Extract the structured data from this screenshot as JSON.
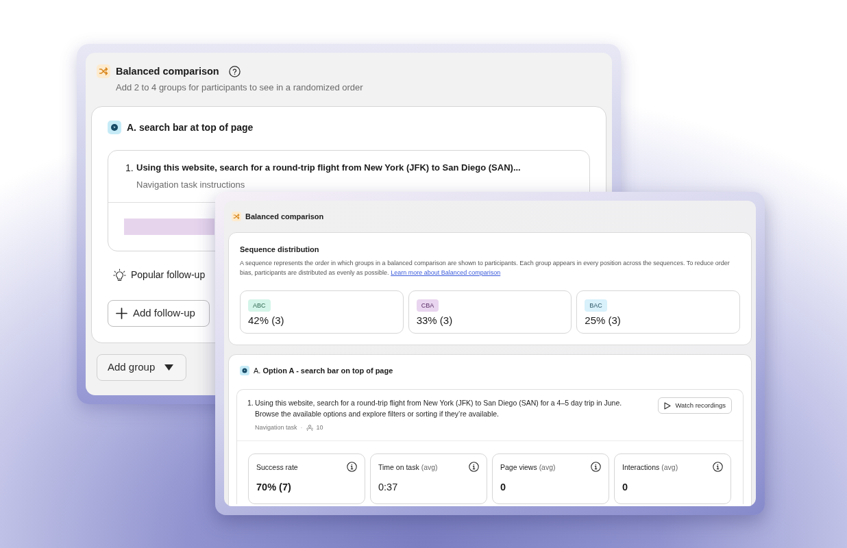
{
  "back_window": {
    "title": "Balanced comparison",
    "subtitle": "Add 2 to 4 groups for participants to see in a randomized order",
    "group": {
      "title": "A. search bar at top of page",
      "task": {
        "number": "1.",
        "text": "Using this website, search for a round-trip flight from New York (JFK) to San Diego (SAN)...",
        "caption": "Navigation task instructions"
      },
      "follow_up_hint": "Popular follow-up",
      "add_follow_up": "Add follow-up"
    },
    "add_group": "Add group"
  },
  "front_window": {
    "title": "Balanced comparison",
    "sequence_distribution": {
      "title": "Sequence distribution",
      "description": "A sequence represents the order in which groups in a balanced comparison are shown to participants. Each group appears in every position across the sequences. To reduce order bias, participants are distributed as evenly as possible.",
      "link": "Learn more about Balanced comparison",
      "sequences": [
        {
          "tag": "ABC",
          "color": "#d4f5e9",
          "share": "42% (3)"
        },
        {
          "tag": "CBA",
          "color": "#e9d5ef",
          "share": "33% (3)"
        },
        {
          "tag": "BAC",
          "color": "#d8f1fb",
          "share": "25% (3)"
        }
      ]
    },
    "group": {
      "title": "A. **Option A - search bar on top of page**",
      "task": {
        "number": "1.",
        "text": "Using this website, search for a round-trip flight from New York (JFK) to San Diego (SAN) for a 4–5 day trip in June. Browse the available options and explore filters or sorting if they’re available.",
        "type": "Navigation task",
        "separator": "·",
        "participants": "10",
        "button": "Watch recordings"
      },
      "metrics": [
        {
          "label": "Success rate",
          "value": "70% (7)",
          "emphasized": true
        },
        {
          "label": "Time on task",
          "unit": "(avg)",
          "value": "0:37",
          "emphasized": false
        },
        {
          "label": "Page views",
          "unit": "(avg)",
          "value": "0",
          "emphasized": true
        },
        {
          "label": "Interactions",
          "unit": "(avg)",
          "value": "0",
          "emphasized": true
        }
      ]
    }
  }
}
